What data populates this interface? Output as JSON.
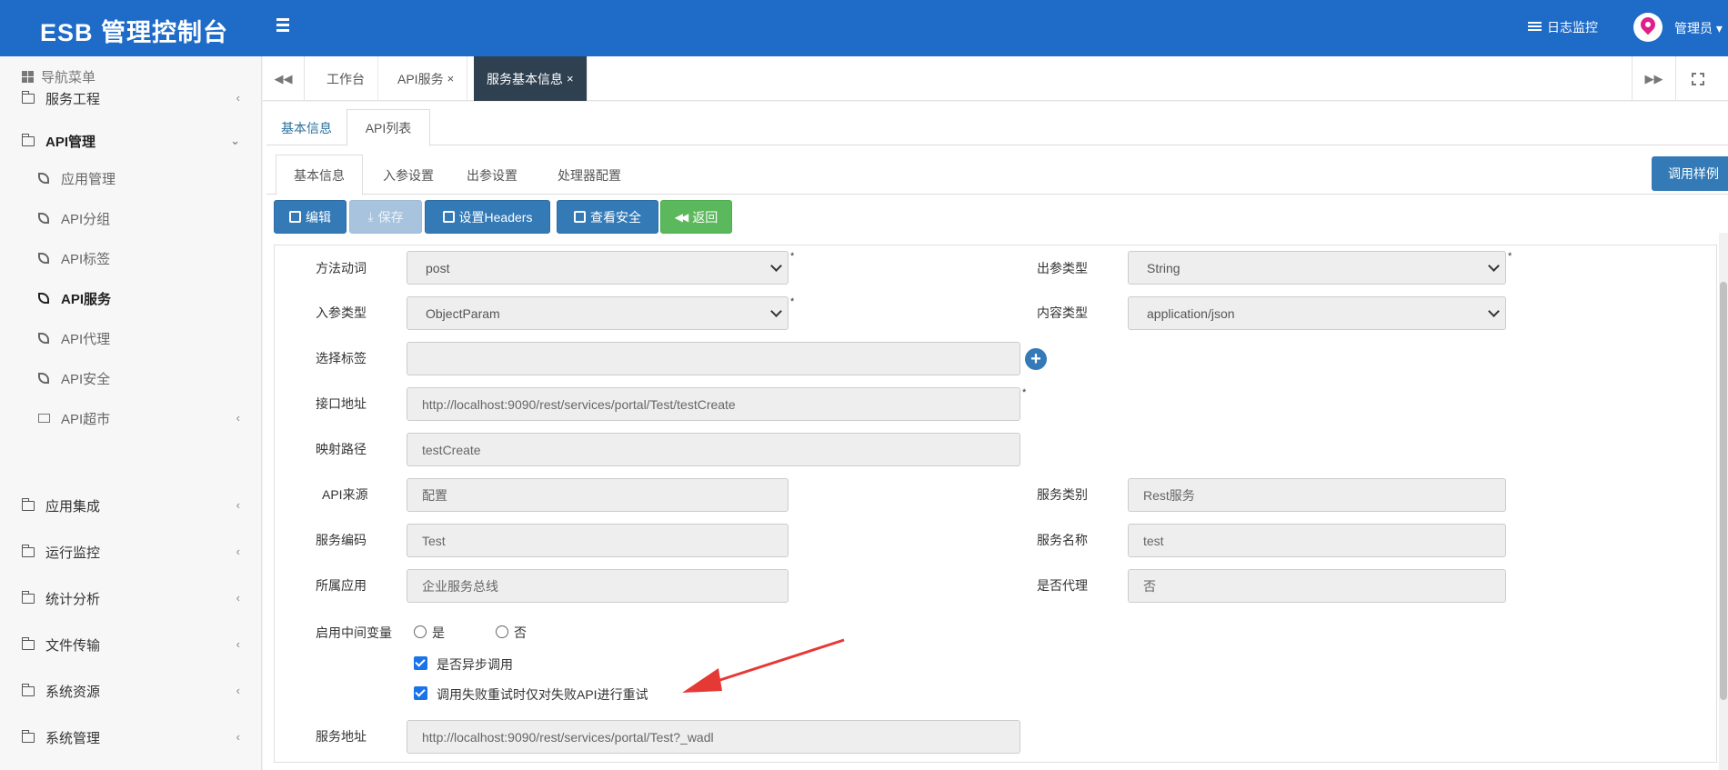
{
  "header": {
    "brand": "ESB 管理控制台",
    "log_monitor": "日志监控",
    "admin": "管理员 ▾"
  },
  "sidebar": {
    "title": "导航菜单",
    "items": [
      {
        "label": "服务工程",
        "chevron": "‹"
      },
      {
        "label": "API管理",
        "chevron": "⌄"
      },
      {
        "label": "应用集成",
        "chevron": "‹"
      },
      {
        "label": "运行监控",
        "chevron": "‹"
      },
      {
        "label": "统计分析",
        "chevron": "‹"
      },
      {
        "label": "文件传输",
        "chevron": "‹"
      },
      {
        "label": "系统资源",
        "chevron": "‹"
      },
      {
        "label": "系统管理",
        "chevron": "‹"
      }
    ],
    "api_sub": [
      {
        "label": "应用管理"
      },
      {
        "label": "API分组"
      },
      {
        "label": "API标签"
      },
      {
        "label": "API服务"
      },
      {
        "label": "API代理"
      },
      {
        "label": "API安全"
      },
      {
        "label": "API超市",
        "chevron": "‹"
      }
    ]
  },
  "page_tabs": {
    "prev": "◀◀",
    "next": "▶▶",
    "tabs": [
      {
        "label": "工作台"
      },
      {
        "label": "API服务",
        "close": "×"
      },
      {
        "label": "服务基本信息",
        "close": "×"
      }
    ]
  },
  "tabs_level1": [
    "基本信息",
    "API列表"
  ],
  "tabs_level2": [
    "基本信息",
    "入参设置",
    "出参设置",
    "处理器配置"
  ],
  "call_sample": "调用样例",
  "toolbar": {
    "edit": "编辑",
    "save": "保存",
    "headers": "设置Headers",
    "security": "查看安全",
    "back": "返回"
  },
  "form": {
    "method": {
      "label": "方法动词",
      "value": "post"
    },
    "out_type": {
      "label": "出参类型",
      "value": "String"
    },
    "in_type": {
      "label": "入参类型",
      "value": "ObjectParam"
    },
    "content_type": {
      "label": "内容类型",
      "value": "application/json"
    },
    "tags": {
      "label": "选择标签",
      "value": ""
    },
    "endpoint": {
      "label": "接口地址",
      "value": "http://localhost:9090/rest/services/portal/Test/testCreate"
    },
    "mapping": {
      "label": "映射路径",
      "value": "testCreate"
    },
    "api_source": {
      "label": "API来源",
      "value": "配置"
    },
    "service_category": {
      "label": "服务类别",
      "value": "Rest服务"
    },
    "service_code": {
      "label": "服务编码",
      "value": "Test"
    },
    "service_name": {
      "label": "服务名称",
      "value": "test"
    },
    "app": {
      "label": "所属应用",
      "value": "企业服务总线"
    },
    "is_proxy": {
      "label": "是否代理",
      "value": "否"
    },
    "middle_var": {
      "label": "启用中间变量",
      "yes": "是",
      "no": "否"
    },
    "async": {
      "label": "是否异步调用",
      "checked": true
    },
    "retry": {
      "label": "调用失败重试时仅对失败API进行重试",
      "checked": true
    },
    "service_addr": {
      "label": "服务地址",
      "value": "http://localhost:9090/rest/services/portal/Test?_wadl"
    },
    "required_mark": "*"
  },
  "colors": {
    "topbar": "#1e6bc8",
    "primary": "#337ab7",
    "success": "#5cb85c",
    "active_tab": "#2f4050",
    "annotation_arrow": "#e53935"
  }
}
